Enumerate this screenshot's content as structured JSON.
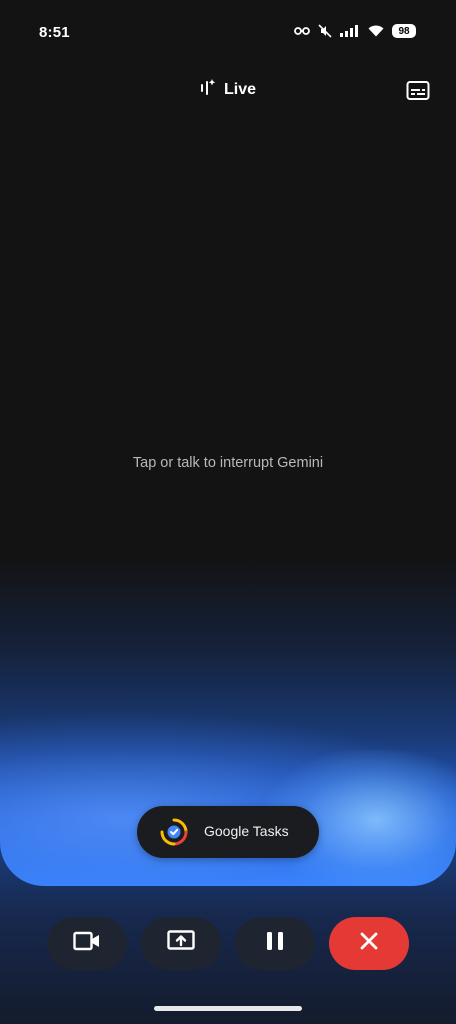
{
  "status_bar": {
    "time": "8:51",
    "battery": "98"
  },
  "header": {
    "title": "Live",
    "captions_icon": "captions-icon"
  },
  "main": {
    "hint": "Tap or talk to interrupt Gemini"
  },
  "app_chip": {
    "label": "Google Tasks",
    "icon": "google-tasks-icon"
  },
  "controls": [
    {
      "icon": "video-camera-icon"
    },
    {
      "icon": "share-screen-icon"
    },
    {
      "icon": "pause-icon"
    },
    {
      "icon": "close-icon",
      "color": "#e53935"
    }
  ],
  "colors": {
    "background": "#131314",
    "accent_blue": "#3a86ff",
    "end_button": "#e53935"
  }
}
